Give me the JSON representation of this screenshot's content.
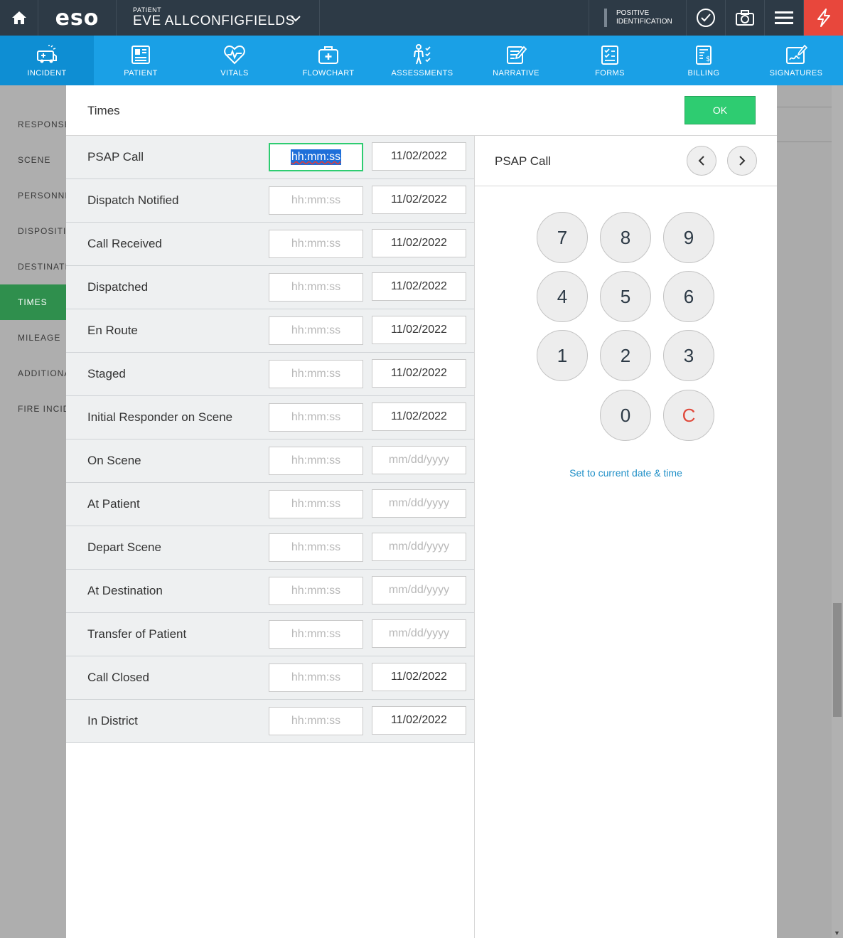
{
  "topbar": {
    "home_icon": "home-icon",
    "logo": "eso",
    "patient_label": "PATIENT",
    "patient_name": "EVE ALLCONFIGFIELDS",
    "positive_id_line1": "POSITIVE",
    "positive_id_line2": "IDENTIFICATION",
    "icons": [
      "check-circle-icon",
      "camera-icon",
      "menu-icon",
      "flash-icon"
    ]
  },
  "nav": {
    "tabs": [
      {
        "label": "INCIDENT",
        "icon": "ambulance-icon",
        "active": true
      },
      {
        "label": "PATIENT",
        "icon": "id-card-icon"
      },
      {
        "label": "VITALS",
        "icon": "heartbeat-icon"
      },
      {
        "label": "FLOWCHART",
        "icon": "medkit-icon"
      },
      {
        "label": "ASSESSMENTS",
        "icon": "body-checklist-icon"
      },
      {
        "label": "NARRATIVE",
        "icon": "notepad-icon"
      },
      {
        "label": "FORMS",
        "icon": "form-checklist-icon"
      },
      {
        "label": "BILLING",
        "icon": "billing-icon"
      },
      {
        "label": "SIGNATURES",
        "icon": "signature-icon"
      }
    ]
  },
  "sidebar": {
    "items": [
      "RESPONSE",
      "SCENE",
      "PERSONNEL",
      "DISPOSITION",
      "DESTINATION",
      "TIMES",
      "MILEAGE",
      "ADDITIONAL",
      "FIRE INCIDENT"
    ],
    "active": "TIMES"
  },
  "modal": {
    "title": "Times",
    "ok_label": "OK",
    "time_placeholder": "hh:mm:ss",
    "date_placeholder": "mm/dd/yyyy",
    "rows": [
      {
        "label": "PSAP Call",
        "date": "11/02/2022"
      },
      {
        "label": "Dispatch Notified",
        "date": "11/02/2022"
      },
      {
        "label": "Call Received",
        "date": "11/02/2022"
      },
      {
        "label": "Dispatched",
        "date": "11/02/2022"
      },
      {
        "label": "En Route",
        "date": "11/02/2022"
      },
      {
        "label": "Staged",
        "date": "11/02/2022"
      },
      {
        "label": "Initial Responder on Scene",
        "date": "11/02/2022"
      },
      {
        "label": "On Scene",
        "date": ""
      },
      {
        "label": "At Patient",
        "date": ""
      },
      {
        "label": "Depart Scene",
        "date": ""
      },
      {
        "label": "At Destination",
        "date": ""
      },
      {
        "label": "Transfer of Patient",
        "date": ""
      },
      {
        "label": "Call Closed",
        "date": "11/02/2022"
      },
      {
        "label": "In District",
        "date": "11/02/2022"
      }
    ],
    "keypad": {
      "title": "PSAP Call",
      "keys": [
        "7",
        "8",
        "9",
        "4",
        "5",
        "6",
        "1",
        "2",
        "3",
        "0",
        "C"
      ],
      "set_current": "Set to current date & time"
    }
  },
  "colors": {
    "topbar_bg": "#2d3a46",
    "nav_bg": "#1aa0e6",
    "ok_green": "#2ecc71",
    "sidebar_active": "#2f8f4d",
    "clear_red": "#e04a3c",
    "link_blue": "#1f8fc7"
  }
}
